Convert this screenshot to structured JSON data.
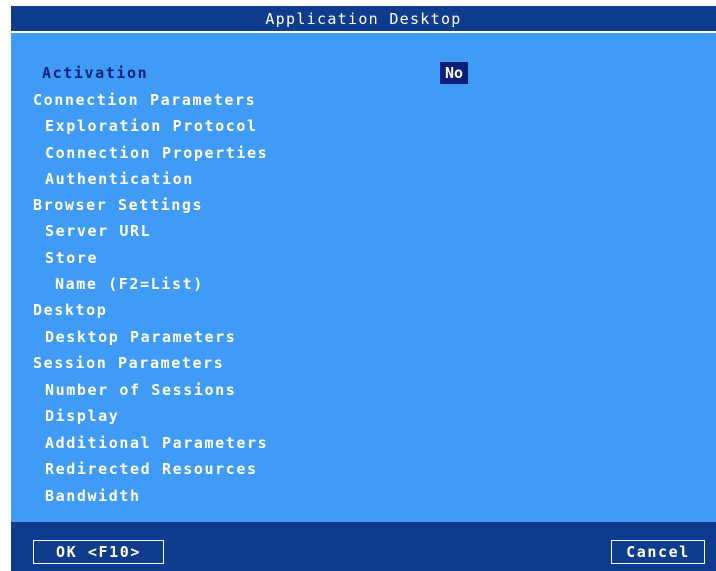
{
  "window": {
    "title": "Application Desktop"
  },
  "activation": {
    "label": "Activation",
    "value": "No"
  },
  "menu": [
    "Connection Parameters",
    "Exploration Protocol",
    "Connection Properties",
    "Authentication",
    "Browser Settings",
    "Server URL",
    "Store",
    "Name (F2=List)",
    "Desktop",
    "Desktop Parameters",
    "Session Parameters",
    "Number of Sessions",
    "Display",
    "Additional Parameters",
    "Redirected Resources",
    "Bandwidth"
  ],
  "buttons": {
    "ok": "OK <F10>",
    "cancel": "Cancel"
  },
  "colors": {
    "background": "#3f9bf6",
    "titlebar": "#0f3c8d",
    "active_text": "#0a1f78"
  }
}
